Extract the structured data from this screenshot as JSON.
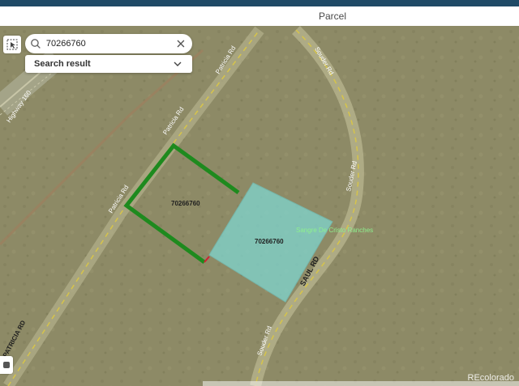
{
  "header": {
    "title": "Parcel"
  },
  "search": {
    "value": "70266760",
    "result_label": "Search result"
  },
  "map": {
    "roads": {
      "highway": "Highway 160",
      "patricia_1": "Patricia Rd",
      "patricia_2": "Patricia Rd",
      "patricia_3": "Patricia Rd",
      "patricia_lower": "PATRICIA RD",
      "souder_1": "Souder Rd",
      "souder_2": "Souder Rd",
      "souder_3": "Souder Rd",
      "saul_rd": "SAUL RD"
    },
    "parcel_label_1": "70266760",
    "parcel_label_2": "70266760",
    "subdivision_label": "Sangre De Cristo Ranches",
    "colors": {
      "outline": "#1e8a1e",
      "highlight": "#7fd6d0",
      "road": "#d6c44a"
    }
  },
  "watermark": "REcolorado"
}
